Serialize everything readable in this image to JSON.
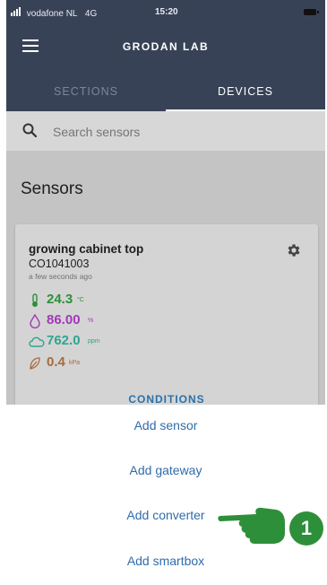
{
  "status_bar": {
    "carrier": "vodafone NL",
    "network": "4G",
    "time": "15:20"
  },
  "header": {
    "title": "GRODAN LAB",
    "menu_icon": "hamburger-menu-icon"
  },
  "tabs": [
    {
      "label": "SECTIONS",
      "active": false
    },
    {
      "label": "DEVICES",
      "active": true
    }
  ],
  "search": {
    "placeholder": "Search sensors",
    "value": ""
  },
  "main": {
    "title": "Sensors",
    "card": {
      "name": "growing cabinet top",
      "id": "CO1041003",
      "updated": "a few seconds ago",
      "readings": [
        {
          "icon": "thermometer-icon",
          "value": "24.3",
          "unit": "°C",
          "color": "#2e8f3a"
        },
        {
          "icon": "humidity-drop-icon",
          "value": "86.00",
          "unit": "%",
          "color": "#a13ab8"
        },
        {
          "icon": "co2-cloud-icon",
          "value": "762.0",
          "unit": "ppm",
          "color": "#2ea58e"
        },
        {
          "icon": "leaf-vpd-icon",
          "value": "0.4",
          "unit": "kPa",
          "color": "#a86a3e"
        }
      ],
      "link": "CONDITIONS"
    }
  },
  "sheet": {
    "items": [
      "Add sensor",
      "Add gateway",
      "Add converter",
      "Add smartbox"
    ]
  },
  "annotation": {
    "step": "1",
    "color": "#2e8f3a"
  },
  "colors": {
    "header_bg": "#384257",
    "accent_link": "#2f6cab"
  }
}
